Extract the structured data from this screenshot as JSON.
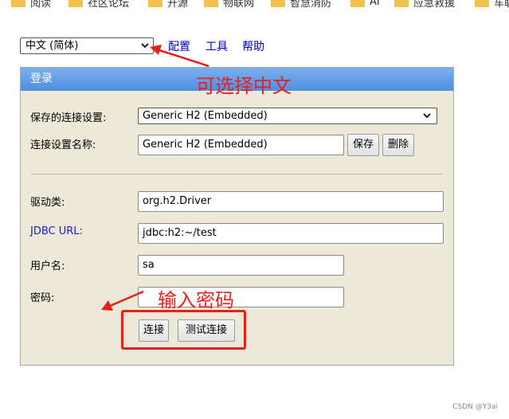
{
  "bookmarks": [
    "阅读",
    "社区论坛",
    "开源",
    "物联网",
    "智慧消防",
    "AI",
    "应急救援",
    "车联"
  ],
  "language_select": {
    "value": "中文 (简体)"
  },
  "top_links": {
    "config": "配置",
    "tools": "工具",
    "help": "帮助"
  },
  "panel": {
    "title": "登录",
    "saved_settings_label": "保存的连接设置:",
    "saved_settings_value": "Generic H2 (Embedded)",
    "setting_name_label": "连接设置名称:",
    "setting_name_value": "Generic H2 (Embedded)",
    "save_button": "保存",
    "delete_button": "删除",
    "driver_label": "驱动类:",
    "driver_value": "org.h2.Driver",
    "jdbc_label": "JDBC URL:",
    "jdbc_value": "jdbc:h2:~/test",
    "user_label": "用户名:",
    "user_value": "sa",
    "password_label": "密码:",
    "password_value": "",
    "connect_button": "连接",
    "test_button": "测试连接"
  },
  "annotations": {
    "select_chinese": "可选择中文",
    "enter_password": "输入密码"
  },
  "watermark": "CSDN @Y3ai",
  "colors": {
    "annotation": "#e8201a",
    "header": "#5a97e4",
    "panel_bg": "#ece9d8",
    "link": "#0000cc"
  }
}
